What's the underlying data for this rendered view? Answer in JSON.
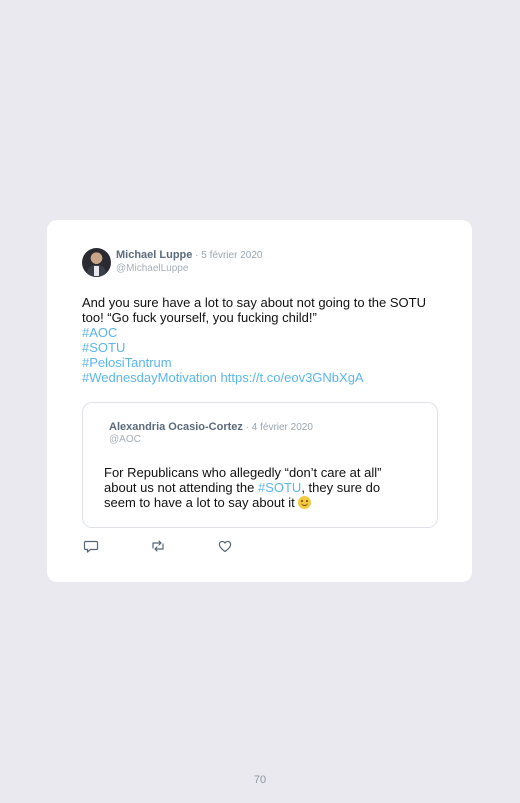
{
  "tweet": {
    "author_name": "Michael Luppe",
    "separator": " · ",
    "date": "5 février 2020",
    "handle": "@MichaelLuppe",
    "text_line1": "And you sure have a lot to say about not going to the SOTU",
    "text_line2": "too! “Go fuck yourself, you fucking child!”",
    "hashtags": [
      "#AOC",
      "#SOTU",
      "#PelosiTantrum",
      "#WednesdayMotivation"
    ],
    "link": "https://t.co/eov3GNbXgA"
  },
  "quoted_tweet": {
    "author_name": "Alexandria Ocasio-Cortez",
    "separator": " · ",
    "date": "4 février 2020",
    "handle": "@AOC",
    "text_line1": "For Republicans who allegedly “don’t care at all”",
    "text_line2_before": "about us not attending the ",
    "text_line2_hashtag": "#SOTU",
    "text_line2_after": ", they sure do",
    "text_line3": "seem to have a lot to say about it",
    "emoji": "slightly-smiling-face-emoji"
  },
  "actions": {
    "reply_icon": "reply-icon",
    "retweet_icon": "retweet-icon",
    "like_icon": "heart-icon"
  },
  "page_number": "70",
  "colors": {
    "background": "#e9e9ef",
    "link": "#5bb6ec",
    "card": "#ffffff"
  }
}
